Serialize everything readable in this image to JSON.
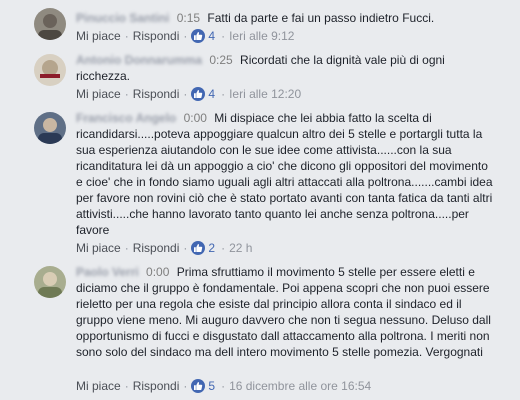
{
  "comments": [
    {
      "author": "Pinuccio Santini",
      "timestamp": "0:15",
      "text": "Fatti da parte e fai un passo indietro Fucci.",
      "like_label": "Mi piace",
      "reply_label": "Rispondi",
      "likes": "4",
      "time": "Ieri alle 9:12"
    },
    {
      "author": "Antonio Donnarumma",
      "timestamp": "0:25",
      "text": "Ricordati che la dignità vale più di ogni ricchezza.",
      "like_label": "Mi piace",
      "reply_label": "Rispondi",
      "likes": "4",
      "time": "Ieri alle 12:20"
    },
    {
      "author": "Francisco Angelo",
      "timestamp": "0:00",
      "text": "Mi dispiace che lei abbia fatto la scelta di ricandidarsi.....poteva appoggiare qualcun altro dei 5 stelle e portargli tutta la sua esperienza aiutandolo con le sue idee come attivista......con la sua ricanditatura lei dà un appoggio a cio' che dicono gli oppositori del movimento e cioe' che in fondo siamo uguali agli altri attaccati alla poltrona.......cambi idea per favore non rovini ciò che è stato portato avanti con tanta fatica da tanti altri attivisti.....che hanno lavorato tanto quanto lei anche senza poltrona.....per favore",
      "like_label": "Mi piace",
      "reply_label": "Rispondi",
      "likes": "2",
      "time": "22 h"
    },
    {
      "author": "Paolo Verri",
      "timestamp": "0:00",
      "text": "Prima sfruttiamo il movimento 5 stelle per essere eletti e diciamo che il gruppo è fondamentale. Poi appena scopri che non puoi essere rieletto per una regola che esiste dal principio allora conta il sindaco ed il gruppo viene meno. Mi auguro davvero che non ti segua nessuno. Deluso dall opportunismo di fucci e disgustato dall attaccamento alla poltrona. I meriti non sono solo del sindaco ma dell intero movimento 5 stelle pomezia. Vergognati",
      "like_label": "Mi piace",
      "reply_label": "Rispondi",
      "likes": "5",
      "time": "16 dicembre alle ore 16:54"
    }
  ],
  "colors": {
    "background": "#e9ebee",
    "link": "#4267b2",
    "text": "#1d2129",
    "meta": "#90949c"
  },
  "icons": {
    "like": "thumbs-up-icon"
  }
}
